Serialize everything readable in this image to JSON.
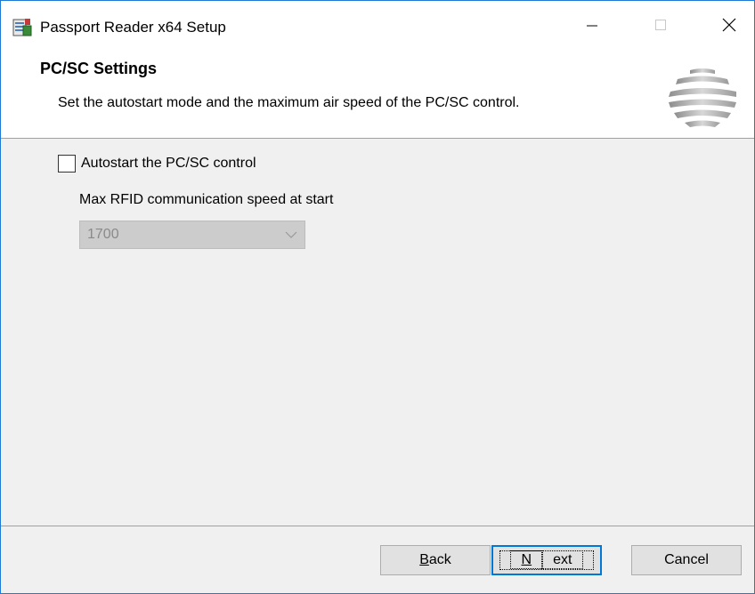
{
  "window": {
    "title": "Passport Reader x64 Setup",
    "icon": "installer-icon",
    "controls": {
      "minimize_icon": "minimize-icon",
      "maximize_icon": "maximize-icon",
      "close_icon": "close-icon"
    }
  },
  "header": {
    "title": "PC/SC Settings",
    "description": "Set the autostart mode and the maximum air speed of the PC/SC control.",
    "logo": "striped-sphere-logo"
  },
  "content": {
    "autostart": {
      "label": "Autostart the PC/SC control",
      "checked": false
    },
    "speed": {
      "label": "Max RFID communication speed at start",
      "selected_value": "1700",
      "disabled": true
    }
  },
  "footer": {
    "back": {
      "accel": "B",
      "rest": "ack"
    },
    "next": {
      "accel": "N",
      "rest": "ext"
    },
    "cancel": "Cancel"
  },
  "colors": {
    "accent": "#0078d7",
    "window_border": "#1e7ad4",
    "dialog_bg": "#f0f0f0"
  }
}
